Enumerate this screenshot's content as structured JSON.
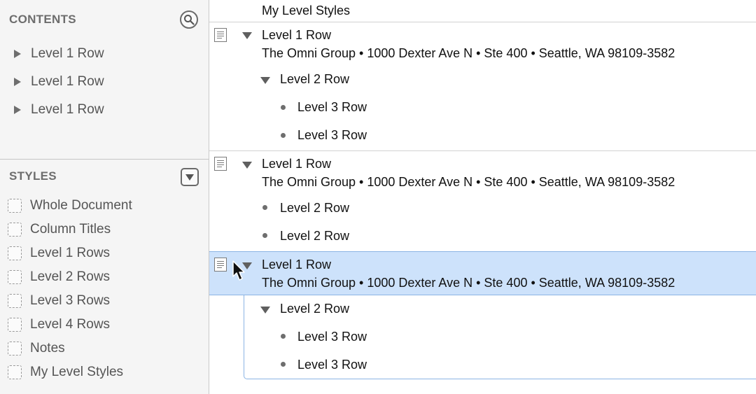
{
  "sidebar": {
    "contents": {
      "title": "CONTENTS",
      "search_icon": "search-icon",
      "items": [
        {
          "label": "Level 1 Row"
        },
        {
          "label": "Level 1 Row"
        },
        {
          "label": "Level 1 Row"
        }
      ]
    },
    "styles": {
      "title": "STYLES",
      "menu_icon": "triangle-down-icon",
      "items": [
        {
          "label": "Whole Document"
        },
        {
          "label": "Column Titles"
        },
        {
          "label": "Level 1 Rows"
        },
        {
          "label": "Level 2 Rows"
        },
        {
          "label": "Level 3 Rows"
        },
        {
          "label": "Level 4 Rows"
        },
        {
          "label": "Notes"
        },
        {
          "label": "My Level Styles"
        }
      ]
    }
  },
  "outline": {
    "header": "My Level Styles",
    "address": "The Omni Group • 1000 Dexter Ave N • Ste 400 • Seattle, WA 98109-3582",
    "groups": [
      {
        "title": "Level 1 Row",
        "children": [
          {
            "title": "Level 2 Row",
            "children": [
              {
                "title": "Level 3 Row"
              },
              {
                "title": "Level 3 Row"
              }
            ]
          }
        ]
      },
      {
        "title": "Level 1 Row",
        "children": [
          {
            "title": "Level 2 Row"
          },
          {
            "title": "Level 2 Row"
          }
        ]
      },
      {
        "title": "Level 1 Row",
        "selected": true,
        "children": [
          {
            "title": "Level 2 Row",
            "children": [
              {
                "title": "Level 3 Row"
              },
              {
                "title": "Level 3 Row"
              }
            ]
          }
        ]
      }
    ]
  },
  "colors": {
    "selection": "#cde2fb",
    "selection_border": "#8bb4e4",
    "sidebar_bg": "#f5f5f5"
  }
}
